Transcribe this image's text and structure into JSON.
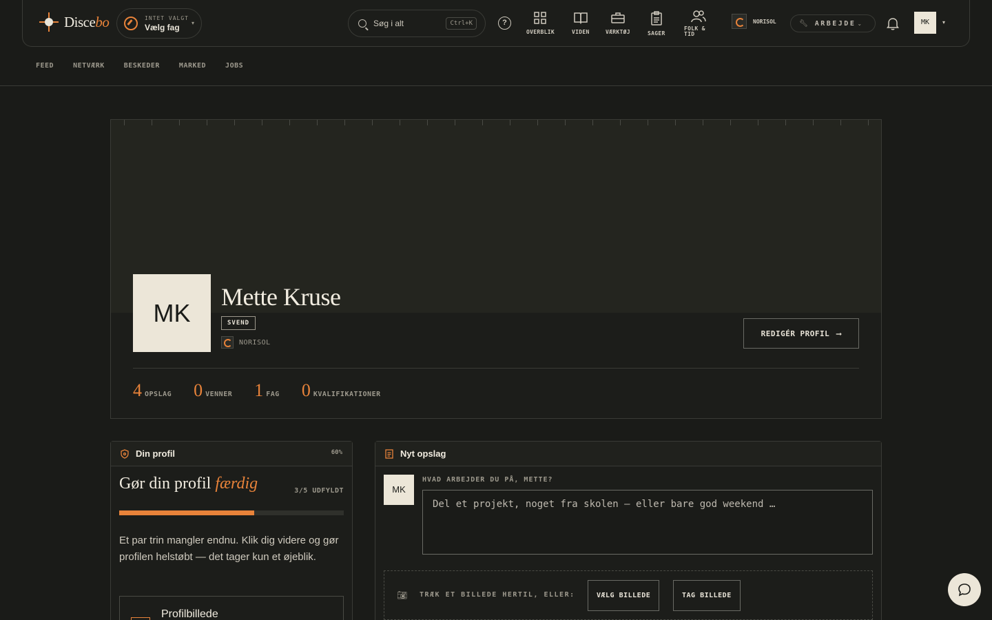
{
  "header": {
    "logo_text": "Disce",
    "logo_suffix": "bo",
    "fag_small": "INTET VALGT",
    "fag_label": "Vælg fag",
    "search_placeholder": "Søg i alt",
    "search_shortcut": "Ctrl+K",
    "nav": [
      {
        "label": "OVERBLIK",
        "icon": "grid-icon"
      },
      {
        "label": "VIDEN",
        "icon": "book-icon"
      },
      {
        "label": "VÆRKTØJ",
        "icon": "briefcase-icon"
      },
      {
        "label": "SAGER",
        "icon": "clipboard-icon"
      },
      {
        "label": "FOLK &",
        "label2": "TID",
        "icon": "people-icon"
      }
    ],
    "company": "NORISOL",
    "mode": "ARBEJDE",
    "user_initials": "MK"
  },
  "subnav": [
    "FEED",
    "NETVÆRK",
    "BESKEDER",
    "MARKED",
    "JOBS"
  ],
  "profile": {
    "initials": "MK",
    "name": "Mette Kruse",
    "role": "SVEND",
    "company": "NORISOL",
    "edit_label": "REDIGÉR PROFIL",
    "stats": [
      {
        "value": "4",
        "label": "OPSLAG"
      },
      {
        "value": "0",
        "label": "VENNER"
      },
      {
        "value": "1",
        "label": "FAG"
      },
      {
        "value": "0",
        "label": "KVALIFIKATIONER"
      }
    ]
  },
  "profile_card": {
    "title": "Din profil",
    "percent": "60%",
    "progress_fraction": 0.6,
    "heading": "Gør din profil",
    "heading_accent": "færdig",
    "filled": "3/5 UDFYLDT",
    "description": "Et par trin mangler endnu. Klik dig videre og gør profilen helstøbt — det tager kun et øjeblik.",
    "step_label": "Profilbillede"
  },
  "post_card": {
    "title": "Nyt opslag",
    "initials": "MK",
    "question": "HVAD ARBEJDER DU PÅ, METTE?",
    "placeholder": "Del et projekt, noget fra skolen — eller bare god weekend …",
    "drop_text": "TRÆK ET BILLEDE HERTIL, ELLER:",
    "choose_label": "VÆLG BILLEDE",
    "take_label": "TAG BILLEDE"
  },
  "colors": {
    "accent": "#e8833a",
    "background": "#1a1b18",
    "ink": "#e9e4d8"
  }
}
